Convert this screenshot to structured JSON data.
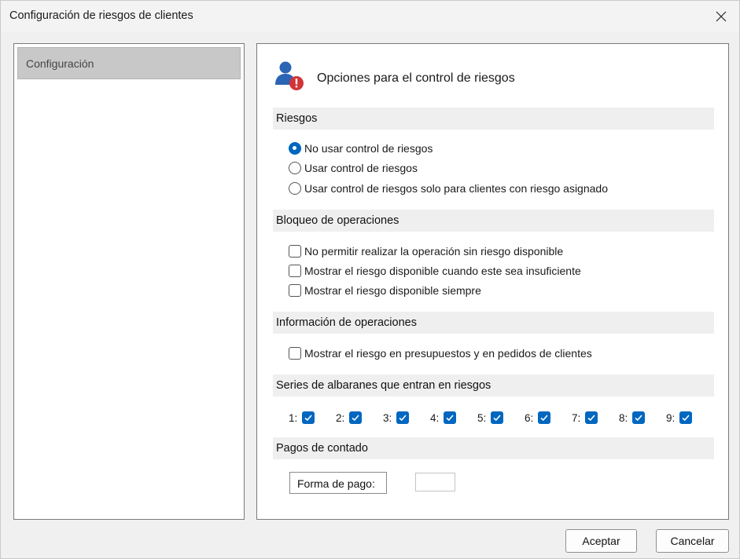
{
  "window": {
    "title": "Configuración de riesgos de clientes"
  },
  "sidebar": {
    "items": [
      {
        "label": "Configuración",
        "selected": true
      }
    ]
  },
  "main": {
    "header_title": "Opciones para el control de riesgos",
    "header_icon": "user-warning-icon",
    "sections": {
      "riesgos": {
        "title": "Riesgos",
        "options": [
          {
            "label": "No usar control de riesgos",
            "selected": true
          },
          {
            "label": "Usar control de riesgos",
            "selected": false
          },
          {
            "label": "Usar control de riesgos solo para clientes con riesgo asignado",
            "selected": false
          }
        ]
      },
      "bloqueo": {
        "title": "Bloqueo de operaciones",
        "options": [
          {
            "label": "No permitir realizar la operación sin riesgo disponible",
            "checked": false
          },
          {
            "label": "Mostrar el riesgo disponible cuando este sea insuficiente",
            "checked": false
          },
          {
            "label": "Mostrar el riesgo disponible siempre",
            "checked": false
          }
        ]
      },
      "informacion": {
        "title": "Información de operaciones",
        "options": [
          {
            "label": "Mostrar el riesgo en presupuestos y en pedidos de clientes",
            "checked": false
          }
        ]
      },
      "series": {
        "title": "Series de albaranes que entran en riesgos",
        "items": [
          {
            "label": "1:",
            "checked": true
          },
          {
            "label": "2:",
            "checked": true
          },
          {
            "label": "3:",
            "checked": true
          },
          {
            "label": "4:",
            "checked": true
          },
          {
            "label": "5:",
            "checked": true
          },
          {
            "label": "6:",
            "checked": true
          },
          {
            "label": "7:",
            "checked": true
          },
          {
            "label": "8:",
            "checked": true
          },
          {
            "label": "9:",
            "checked": true
          }
        ]
      },
      "pagos": {
        "title": "Pagos de contado",
        "forma_label": "Forma de pago:",
        "forma_value": ""
      }
    }
  },
  "footer": {
    "accept_label": "Aceptar",
    "cancel_label": "Cancelar"
  },
  "colors": {
    "accent": "#0067c0",
    "warning": "#d13438",
    "user": "#2b63b5"
  }
}
